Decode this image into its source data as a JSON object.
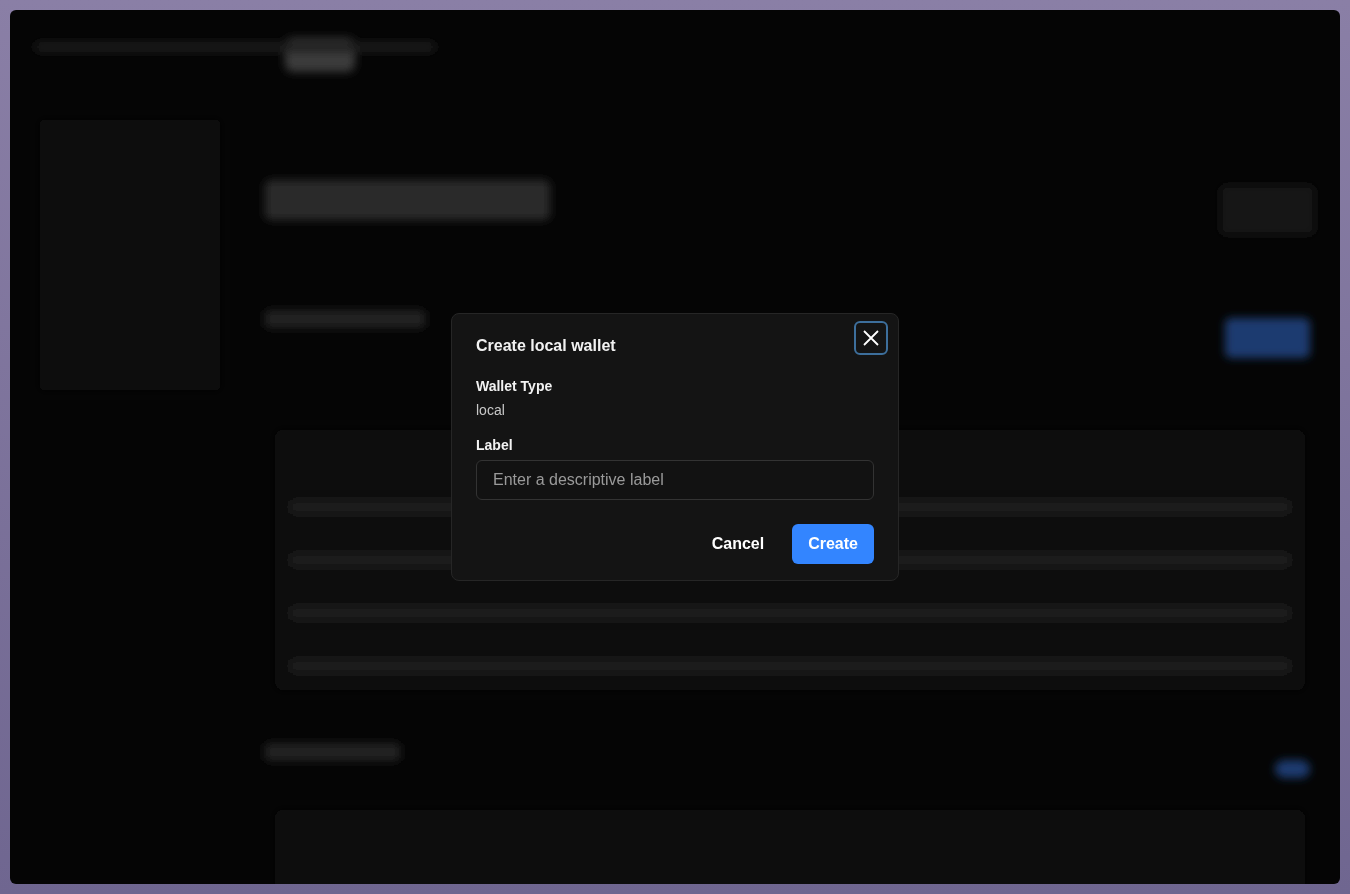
{
  "dialog": {
    "title": "Create local wallet",
    "fields": [
      {
        "kind": "text",
        "label": "Wallet Type",
        "value": "local"
      },
      {
        "kind": "input",
        "label": "Label",
        "placeholder": "Enter a descriptive label"
      }
    ],
    "buttons": [
      {
        "kind": "secondary",
        "label": "Cancel"
      },
      {
        "kind": "primary",
        "label": "Create"
      }
    ]
  }
}
